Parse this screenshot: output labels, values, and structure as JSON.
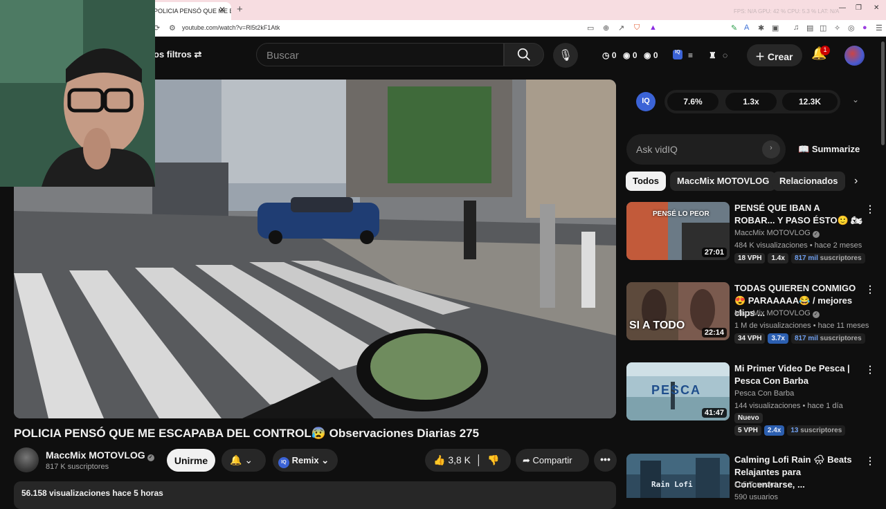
{
  "browser": {
    "tab_title": "POLICIA PENSÓ QUE ME E",
    "url": "youtube.com/watch?v=Rl5t2kF1Atk",
    "perf": "FPS: N/A   GPU: 42 %   CPU: 5.3 %   LAT: N/A"
  },
  "header": {
    "filters_label": "os filtros",
    "search_placeholder": "Buscar",
    "stats": [
      "0",
      "0",
      "0"
    ],
    "create_label": "Crear",
    "notif_count": "1"
  },
  "video": {
    "title": "POLICIA PENSÓ QUE ME ESCAPABA DEL CONTROL😰 Observaciones Diarias 275",
    "channel": "MaccMix MOTOVLOG",
    "subscribers": "817 K suscriptores",
    "subscribe_label": "Unirme",
    "remix_label": "Remix",
    "likes": "3,8 K",
    "share_label": "Compartir",
    "description_head": "56.158 visualizaciones  hace 5 horas"
  },
  "vidiq": {
    "logo": "IQ",
    "metrics": [
      "7.6%",
      "1.3x",
      "12.3K"
    ],
    "ask_placeholder": "Ask vidIQ",
    "summarize_label": "Summarize"
  },
  "chips": [
    "Todos",
    "MaccMix MOTOVLOG",
    "Relacionados"
  ],
  "recommendations": [
    {
      "title": "PENSÉ QUE IBAN A ROBAR... Y PASO ÉSTO🙂 🏍",
      "channel": "MaccMix MOTOVLOG",
      "meta": "484 K visualizaciones • hace 2 meses",
      "duration": "27:01",
      "vph": "18 VPH",
      "mult": "1.4x",
      "subs_num": "817 mil",
      "subs_word": "suscriptores",
      "thumb_text": "PENSÉ LO PEOR"
    },
    {
      "title": "TODAS QUIEREN CONMIGO😍 PARAAAAA😂 / mejores clips ...",
      "channel": "MaccMix MOTOVLOG",
      "meta": "1 M de visualizaciones • hace 11 meses",
      "duration": "22:14",
      "vph": "34 VPH",
      "mult": "3.7x",
      "subs_num": "817 mil",
      "subs_word": "suscriptores",
      "thumb_text": "SI A TODO"
    },
    {
      "title": "Mi Primer Video De Pesca | Pesca Con Barba",
      "channel": "Pesca Con Barba",
      "meta": "144 visualizaciones • hace 1 día",
      "duration": "41:47",
      "new_label": "Nuevo",
      "vph": "5 VPH",
      "mult": "2.4x",
      "subs_num": "13",
      "subs_word": "suscriptores",
      "thumb_text": "PESCA"
    },
    {
      "title": "Calming Lofi Rain 🌧 Beats Relajantes para Concentrarse, ...",
      "channel": "Lofi Tone Art",
      "meta": "590 usuarios",
      "thumb_text": "Rain Lofi"
    }
  ]
}
